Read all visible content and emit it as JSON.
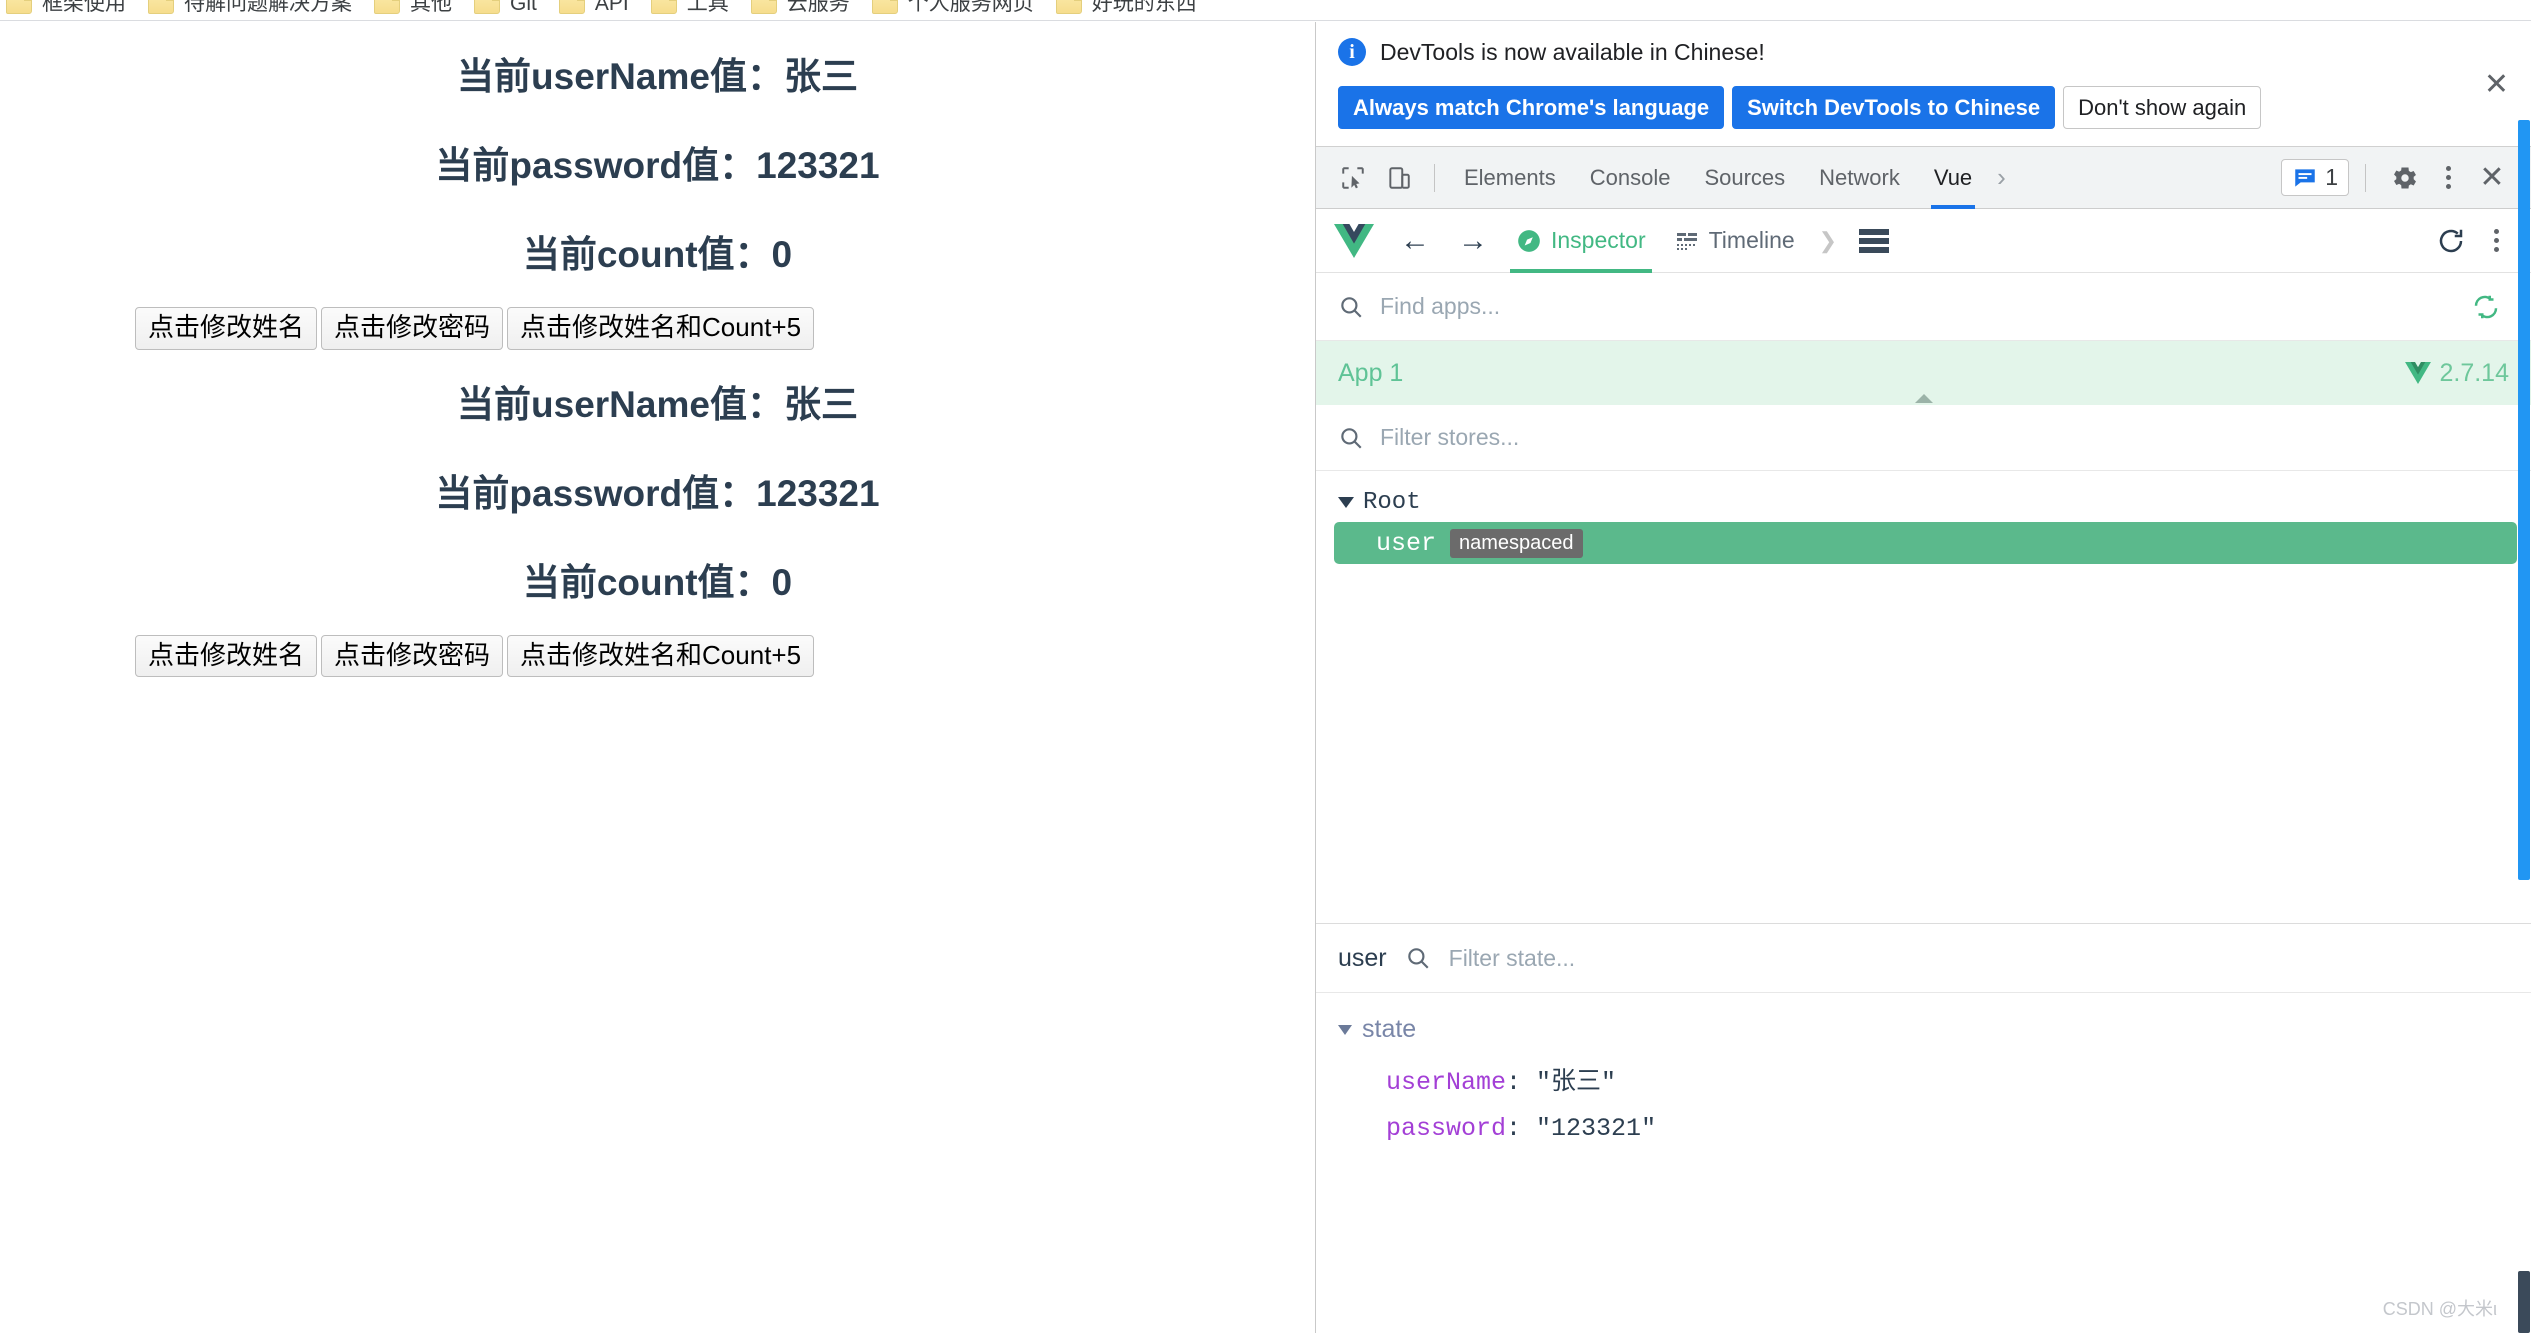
{
  "bookmarks": {
    "items": [
      {
        "label": "框架使用",
        "icon": "folder-icon"
      },
      {
        "label": "待解问题解决方案",
        "icon": "folder-icon"
      },
      {
        "label": "其他",
        "icon": "folder-icon"
      },
      {
        "label": "Git",
        "icon": "folder-icon"
      },
      {
        "label": "API",
        "icon": "folder-icon"
      },
      {
        "label": "工具",
        "icon": "folder-icon"
      },
      {
        "label": "云服务",
        "icon": "folder-icon"
      },
      {
        "label": "个人服务网页",
        "icon": "folder-icon"
      },
      {
        "label": "好玩的东西",
        "icon": "folder-icon"
      }
    ]
  },
  "page": {
    "block1": {
      "line_username": "当前userName值：张三",
      "line_password": "当前password值：123321",
      "line_count": "当前count值：0",
      "buttons": [
        "点击修改姓名",
        "点击修改密码",
        "点击修改姓名和Count+5"
      ]
    },
    "block2": {
      "line_username": "当前userName值：张三",
      "line_password": "当前password值：123321",
      "line_count": "当前count值：0",
      "buttons": [
        "点击修改姓名",
        "点击修改密码",
        "点击修改姓名和Count+5"
      ]
    }
  },
  "devtools": {
    "locale_notice": {
      "icon": "info-icon",
      "message": "DevTools is now available in Chinese!",
      "primary_button_1": "Always match Chrome's language",
      "primary_button_2": "Switch DevTools to Chinese",
      "ghost_button": "Don't show again",
      "close_icon": "close-icon"
    },
    "tabs": {
      "inspect_icon": "inspect-element-icon",
      "device_icon": "device-toolbar-icon",
      "items": [
        {
          "label": "Elements",
          "active": false
        },
        {
          "label": "Console",
          "active": false
        },
        {
          "label": "Sources",
          "active": false
        },
        {
          "label": "Network",
          "active": false
        },
        {
          "label": "Vue",
          "active": true
        }
      ],
      "overflow_icon": "chevron-right-icon",
      "issues_icon": "issues-message-icon",
      "issues_count": "1",
      "settings_icon": "gear-icon",
      "more_icon": "kebab-menu-icon",
      "close_icon": "close-icon",
      "highlight_color": "#ff0000",
      "active_underline_color": "#1a73e8"
    },
    "vue_toolbar": {
      "logo_icon": "vue-logo-icon",
      "back_icon": "arrow-left-icon",
      "forward_icon": "arrow-right-icon",
      "tabs": [
        {
          "label": "Inspector",
          "icon": "inspector-compass-icon",
          "active": true
        },
        {
          "label": "Timeline",
          "icon": "timeline-icon",
          "active": false
        }
      ],
      "chevron_icon": "chevron-right-icon",
      "list_icon": "list-view-icon",
      "refresh_icon": "refresh-icon",
      "more_icon": "kebab-menu-icon",
      "accent_color": "#42b883"
    },
    "find_apps": {
      "search_icon": "search-icon",
      "placeholder": "Find apps...",
      "refresh_icon": "refresh-scan-icon"
    },
    "app_row": {
      "name": "App 1",
      "version": "2.7.14",
      "version_icon": "vue-logo-icon",
      "caret_icon": "caret-up-icon"
    },
    "filter_stores": {
      "search_icon": "search-icon",
      "placeholder": "Filter stores..."
    },
    "store_tree": {
      "root_label": "Root",
      "root_toggle_icon": "triangle-down-icon",
      "nodes": [
        {
          "name": "user",
          "badge": "namespaced",
          "selected": true
        }
      ]
    },
    "state_header": {
      "scope": "user",
      "search_icon": "search-icon",
      "placeholder": "Filter state..."
    },
    "state_body": {
      "group_label": "state",
      "group_toggle_icon": "triangle-down-icon",
      "entries": [
        {
          "key": "userName",
          "value": "\"张三\""
        },
        {
          "key": "password",
          "value": "\"123321\""
        }
      ]
    },
    "scrollbar_color": "#2196f3"
  },
  "watermark": "CSDN @大米ι"
}
